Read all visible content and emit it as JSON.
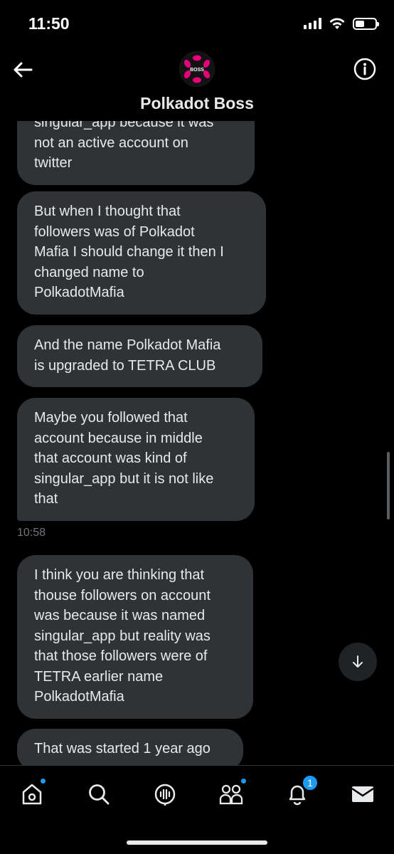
{
  "status_bar": {
    "time": "11:50"
  },
  "header": {
    "contact_name": "Polkadot Boss",
    "avatar_text": "BOSS"
  },
  "messages": [
    {
      "text_lines": [
        "singular_app because it was",
        "not an active account on",
        "twitter"
      ]
    },
    {
      "text_lines": [
        "But when I thought that",
        "followers was of Polkadot",
        "Mafia I should change it then I",
        "changed name to",
        "PolkadotMafia"
      ]
    },
    {
      "text_lines": [
        "And the name Polkadot Mafia",
        "is upgraded to TETRA CLUB"
      ]
    },
    {
      "text_lines": [
        "Maybe you followed that",
        "account because in middle",
        "that account was kind of",
        "singular_app but it is not like",
        "that"
      ]
    },
    {
      "text_lines": [
        "I think you are thinking that",
        "thouse followers on account",
        "was because it was named",
        "singular_app but reality was",
        "that those followers were of",
        "TETRA earlier name",
        "PolkadotMafia"
      ]
    },
    {
      "text_lines": [
        "That was started 1 year ago"
      ]
    }
  ],
  "timestamp": "10:58",
  "tab_bar": {
    "notifications_badge": "1"
  },
  "colors": {
    "bubble": "#2f3336",
    "accent": "#1d9bf0",
    "avatar_pink": "#e6007a"
  }
}
